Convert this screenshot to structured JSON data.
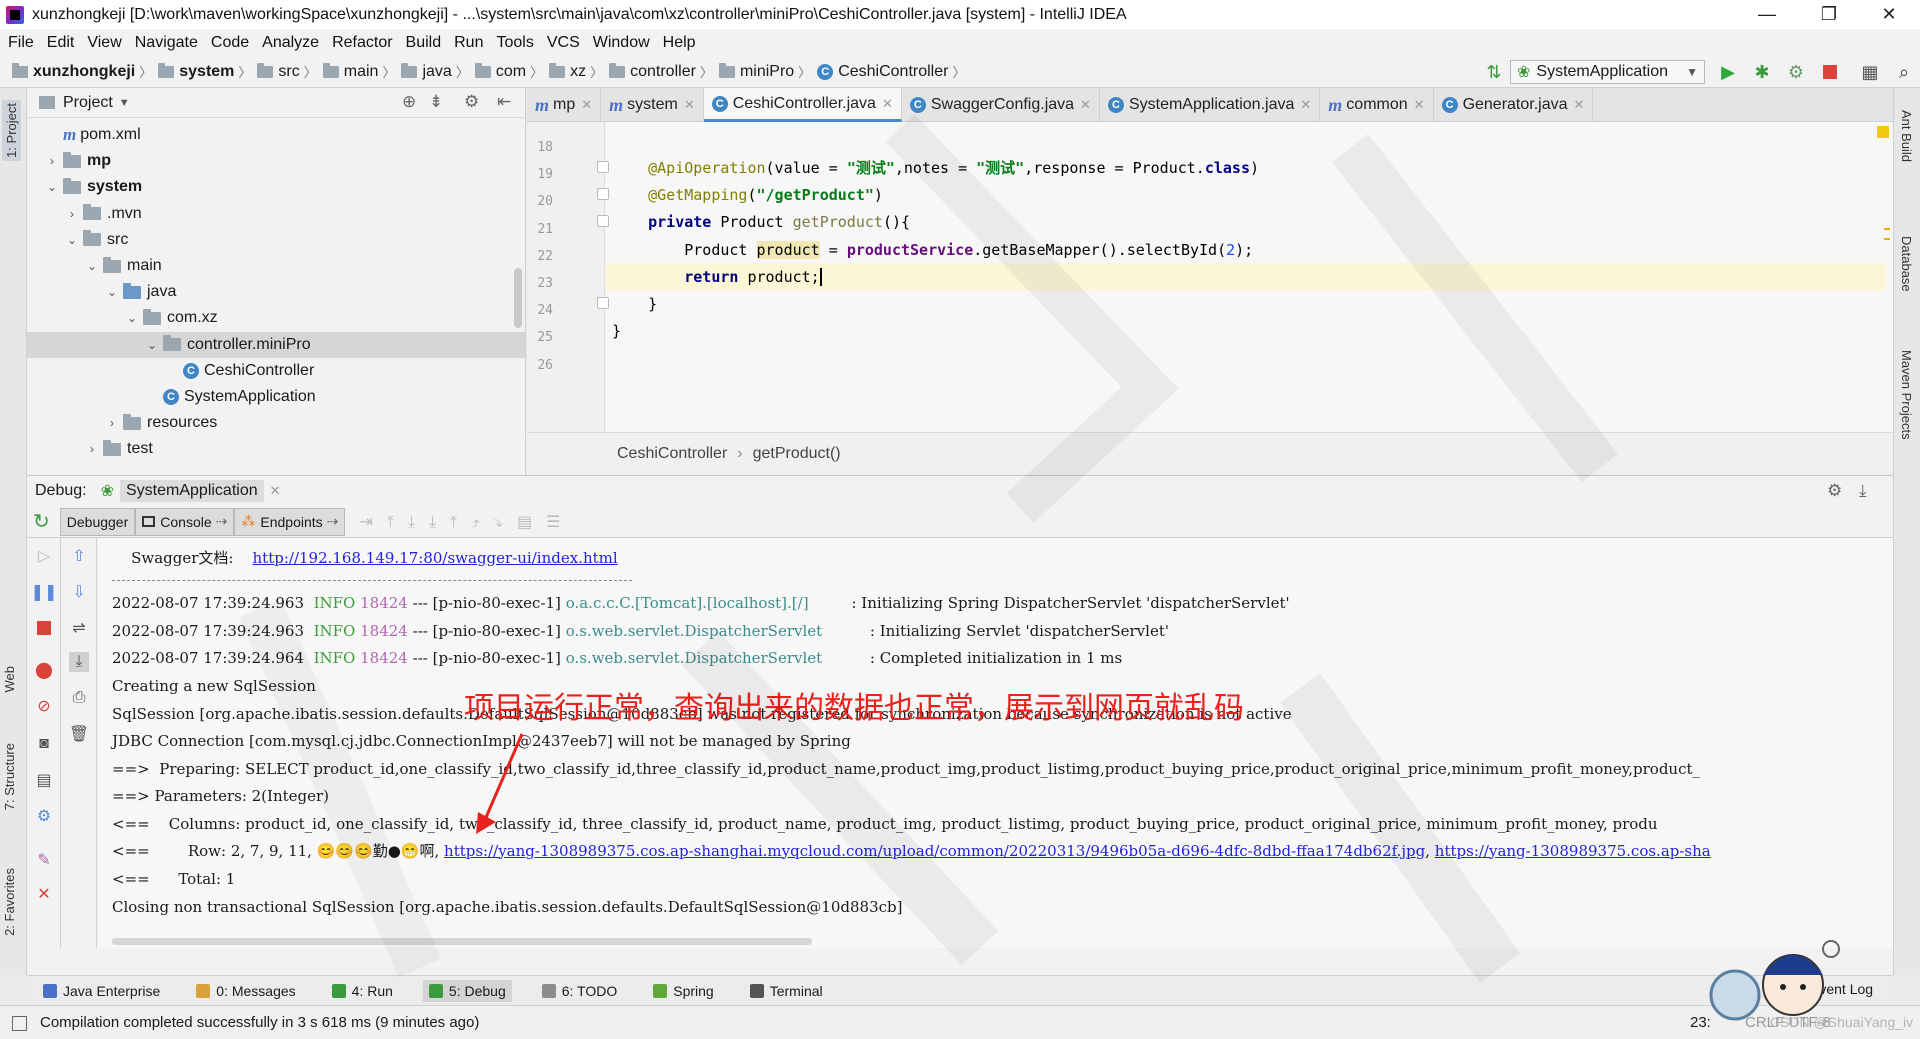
{
  "window": {
    "title": "xunzhongkeji [D:\\work\\maven\\workingSpace\\xunzhongkeji] - ...\\system\\src\\main\\java\\com\\xz\\controller\\miniPro\\CeshiController.java [system] - IntelliJ IDEA",
    "minimize": "—",
    "restore": "❐",
    "close": "✕"
  },
  "menu": [
    "File",
    "Edit",
    "View",
    "Navigate",
    "Code",
    "Analyze",
    "Refactor",
    "Build",
    "Run",
    "Tools",
    "VCS",
    "Window",
    "Help"
  ],
  "navbar": {
    "crumbs": [
      "xunzhongkeji",
      "system",
      "src",
      "main",
      "java",
      "com",
      "xz",
      "controller",
      "miniPro",
      "CeshiController"
    ],
    "run_config": "SystemApplication"
  },
  "left_stripe": {
    "project": "1: Project",
    "web": "Web",
    "structure": "7: Structure",
    "favorites": "2: Favorites"
  },
  "right_stripe": {
    "ant": "Ant Build",
    "database": "Database",
    "maven": "Maven Projects"
  },
  "project": {
    "header": "Project",
    "tree": [
      {
        "label": "pom.xml",
        "kind": "maven",
        "indent": 0
      },
      {
        "label": "mp",
        "kind": "module",
        "indent": 0,
        "arrow": "›"
      },
      {
        "label": "system",
        "kind": "module",
        "indent": 0,
        "arrow": "⌄"
      },
      {
        "label": ".mvn",
        "kind": "folder",
        "indent": 1,
        "arrow": "›"
      },
      {
        "label": "src",
        "kind": "folder",
        "indent": 1,
        "arrow": "⌄"
      },
      {
        "label": "main",
        "kind": "folder",
        "indent": 2,
        "arrow": "⌄"
      },
      {
        "label": "java",
        "kind": "src",
        "indent": 3,
        "arrow": "⌄"
      },
      {
        "label": "com.xz",
        "kind": "folder",
        "indent": 4,
        "arrow": "⌄"
      },
      {
        "label": "controller.miniPro",
        "kind": "folder",
        "indent": 5,
        "arrow": "⌄"
      },
      {
        "label": "CeshiController",
        "kind": "class",
        "indent": 6
      },
      {
        "label": "SystemApplication",
        "kind": "class",
        "indent": 5
      },
      {
        "label": "resources",
        "kind": "folder",
        "indent": 3,
        "arrow": "›"
      },
      {
        "label": "test",
        "kind": "folder",
        "indent": 2,
        "arrow": "›"
      }
    ]
  },
  "editor": {
    "tabs": [
      {
        "label": "mp",
        "kind": "maven"
      },
      {
        "label": "system",
        "kind": "maven"
      },
      {
        "label": "CeshiController.java",
        "kind": "class",
        "active": true
      },
      {
        "label": "SwaggerConfig.java",
        "kind": "class"
      },
      {
        "label": "SystemApplication.java",
        "kind": "class"
      },
      {
        "label": "common",
        "kind": "maven"
      },
      {
        "label": "Generator.java",
        "kind": "class"
      }
    ],
    "line_numbers": [
      "18",
      "19",
      "20",
      "21",
      "22",
      "23",
      "24",
      "25",
      "26"
    ],
    "code": {
      "l19_ann": "@ApiOperation",
      "l19_a": "(value = ",
      "l19_s1": "\"测试\"",
      "l19_b": ",notes = ",
      "l19_s2": "\"测试\"",
      "l19_c": ",response = Product.",
      "l19_kw": "class",
      "l19_d": ")",
      "l20_ann": "@GetMapping",
      "l20_a": "(",
      "l20_s": "\"/getProduct\"",
      "l20_b": ")",
      "l21_kw": "private",
      "l21_a": " Product ",
      "l21_m": "getProduct",
      "l21_b": "(){",
      "l22_a": "Product ",
      "l22_v": "product",
      "l22_b": " = ",
      "l22_f": "productService",
      "l22_c": ".getBaseMapper().selectById(",
      "l22_n": "2",
      "l22_d": ");",
      "l23_kw": "return",
      "l23_a": " product;",
      "l24": "}",
      "l25": "}"
    },
    "breadcrumb": [
      "CeshiController",
      "getProduct()"
    ]
  },
  "debug": {
    "label": "Debug:",
    "config": "SystemApplication",
    "tabs": [
      "Debugger",
      "Console",
      "Endpoints"
    ],
    "console": {
      "swagger_label": "    Swagger文档:    ",
      "swagger_url": "http://192.168.149.17:80/swagger-ui/index.html",
      "log": [
        {
          "ts": "2022-08-07 17:39:24.963",
          "lvl": "INFO",
          "pid": "18424",
          "thr": "--- [p-nio-80-exec-1]",
          "logger": "o.a.c.c.C.[Tomcat].[localhost].[/]",
          "msg": ": Initializing Spring DispatcherServlet 'dispatcherServlet'"
        },
        {
          "ts": "2022-08-07 17:39:24.963",
          "lvl": "INFO",
          "pid": "18424",
          "thr": "--- [p-nio-80-exec-1]",
          "logger": "o.s.web.servlet.DispatcherServlet",
          "msg": ": Initializing Servlet 'dispatcherServlet'"
        },
        {
          "ts": "2022-08-07 17:39:24.964",
          "lvl": "INFO",
          "pid": "18424",
          "thr": "--- [p-nio-80-exec-1]",
          "logger": "o.s.web.servlet.DispatcherServlet",
          "msg": ": Completed initialization in 1 ms"
        }
      ],
      "l_creating": "Creating a new SqlSession",
      "l_sqlsession": "SqlSession [org.apache.ibatis.session.defaults.DefaultSqlSession@10d883cb] was not registered for synchronization because synchronization is not active",
      "l_jdbc": "JDBC Connection [com.mysql.cj.jdbc.ConnectionImpl@2437eeb7] will not be managed by Spring",
      "l_preparing": "==>  Preparing: SELECT product_id,one_classify_id,two_classify_id,three_classify_id,product_name,product_img,product_listimg,product_buying_price,product_original_price,minimum_profit_money,product_",
      "l_params": "==> Parameters: 2(Integer)",
      "l_columns": "<==    Columns: product_id, one_classify_id, two_classify_id, three_classify_id, product_name, product_img, product_listimg, product_buying_price, product_original_price, minimum_profit_money, produ",
      "l_row_a": "<==        Row: 2, 7, 9, 11, 😊😊😊勤●😁啊, ",
      "l_row_url1": "https://yang-1308989375.cos.ap-shanghai.myqcloud.com/upload/common/20220313/9496b05a-d696-4dfc-8dbd-ffaa174db62f.jpg",
      "l_row_sep": ", ",
      "l_row_url2": "https://yang-1308989375.cos.ap-sha",
      "l_total": "<==      Total: 1",
      "l_closing": "Closing non transactional SqlSession [org.apache.ibatis.session.defaults.DefaultSqlSession@10d883cb]"
    },
    "annotation": "项目运行正常，查询出来的数据也正常，展示到网页就乱码"
  },
  "bottom_tools": [
    {
      "label": "Java Enterprise",
      "color": "#4a72c6"
    },
    {
      "label": "0: Messages",
      "color": "#d9a23b"
    },
    {
      "label": "4: Run",
      "color": "#3c9a3c"
    },
    {
      "label": "5: Debug",
      "color": "#3c9a3c",
      "active": true
    },
    {
      "label": "6: TODO",
      "color": "#8c8c8c"
    },
    {
      "label": "Spring",
      "color": "#5fa83c"
    },
    {
      "label": "Terminal",
      "color": "#555555"
    }
  ],
  "event_log": "Event Log",
  "status": {
    "message": "Compilation completed successfully in 3 s 618 ms (9 minutes ago)",
    "position": "23:",
    "encoding": "CRLF UTF-8",
    "watermark": "CSDN @ShuaiYang_iv"
  }
}
